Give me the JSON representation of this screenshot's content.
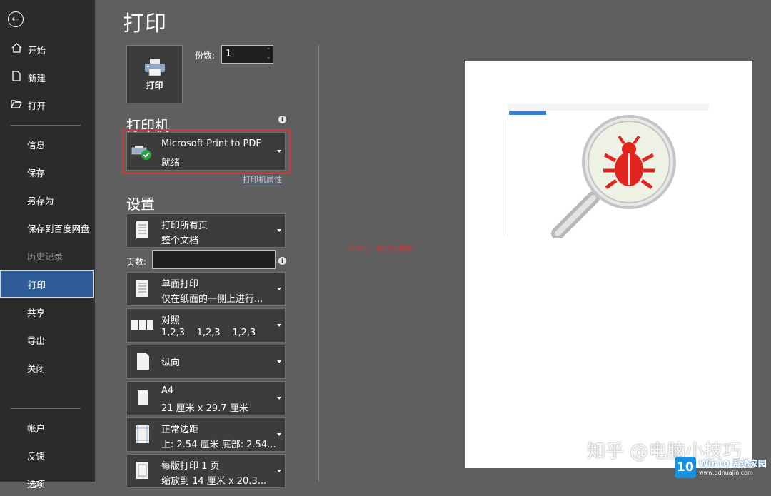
{
  "sidebar": {
    "back_icon": "back-arrow-icon",
    "top_items": [
      {
        "label": "开始",
        "icon": "home-icon"
      },
      {
        "label": "新建",
        "icon": "new-document-icon"
      },
      {
        "label": "打开",
        "icon": "open-folder-icon"
      }
    ],
    "items": [
      {
        "label": "信息"
      },
      {
        "label": "保存"
      },
      {
        "label": "另存为"
      },
      {
        "label": "保存到百度网盘"
      },
      {
        "label": "历史记录",
        "disabled": true
      },
      {
        "label": "打印",
        "active": true
      },
      {
        "label": "共享"
      },
      {
        "label": "导出"
      },
      {
        "label": "关闭"
      }
    ],
    "bottom_items": [
      {
        "label": "帐户"
      },
      {
        "label": "反馈"
      },
      {
        "label": "选项"
      }
    ]
  },
  "main": {
    "title": "打印",
    "print_button_label": "打印",
    "copies_label": "份数:",
    "copies_value": "1"
  },
  "printer": {
    "section_title": "打印机",
    "name": "Microsoft Print to PDF",
    "status": "就绪",
    "properties_link": "打印机属性"
  },
  "settings": {
    "section_title": "设置",
    "pages_label": "页数:",
    "pages_value": "",
    "options": [
      {
        "line1": "打印所有页",
        "line2": "整个文档",
        "icon": "all-pages-icon"
      },
      {
        "line1": "单面打印",
        "line2": "仅在纸面的一侧上进行...",
        "icon": "one-sided-icon"
      },
      {
        "line1": "对照",
        "line2": "1,2,3    1,2,3    1,2,3",
        "icon": "collated-icon"
      },
      {
        "line1": "纵向",
        "line2": "",
        "icon": "portrait-icon"
      },
      {
        "line1": "A4",
        "line2": "21 厘米 x 29.7 厘米",
        "icon": "paper-size-icon"
      },
      {
        "line1": "正常边距",
        "line2": "上: 2.54 厘米 底部: 2.54...",
        "icon": "margins-icon"
      },
      {
        "line1": "每版打印 1 页",
        "line2": "缩放到 14 厘米 x 20.3...",
        "icon": "pages-per-sheet-icon"
      }
    ]
  },
  "preview": {
    "side_note": "公众号：科研小柯数",
    "image_icon": "bug-magnifier-icon"
  },
  "watermarks": {
    "zhihu": "知乎 @电脑小技巧",
    "site_logo_num": "10",
    "site_title": "Win10 系统家园",
    "site_url": "www.qdhuajin.com"
  },
  "colors": {
    "sidebar_bg": "#2b2b2b",
    "main_bg": "#5f5f5f",
    "active_bg": "#2e5d9a",
    "highlight_border": "#d43535",
    "bug_red": "#e0251f"
  }
}
